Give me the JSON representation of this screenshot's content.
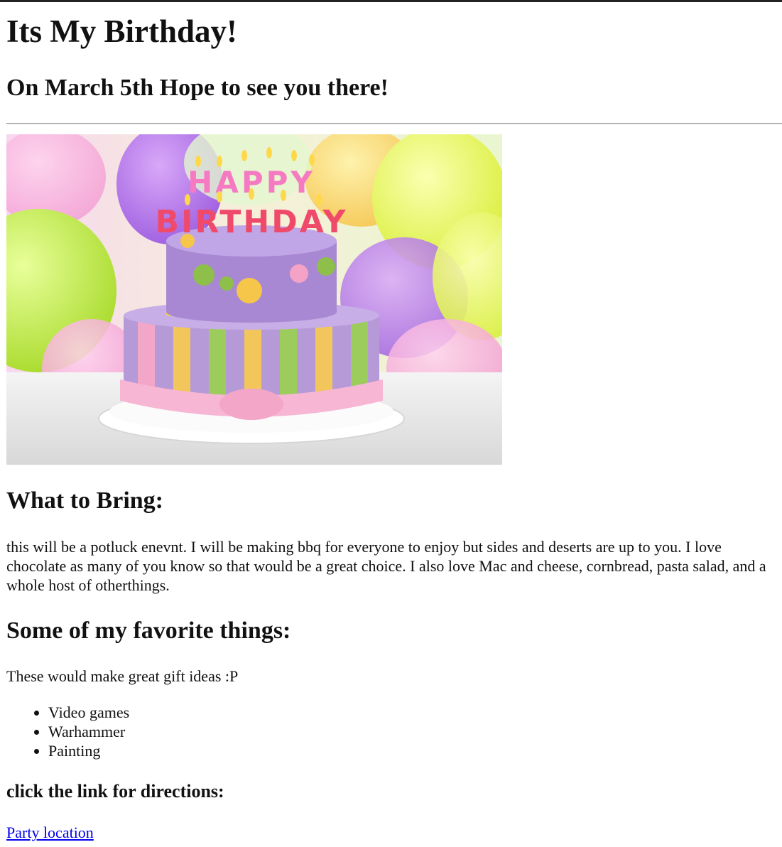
{
  "page": {
    "title": "Its My Birthday!",
    "subtitle": "On March 5th Hope to see you there!"
  },
  "photo": {
    "description_icon": "birthday-cake-image",
    "cake_text_top": "HAPPY",
    "cake_text_bottom": "BIRTHDAY"
  },
  "bring": {
    "heading": "What to Bring:",
    "text": "this will be a potluck enevnt. I will be making bbq for everyone to enjoy but sides and deserts are up to you. I love chocolate as many of you know so that would be a great choice. I also love Mac and cheese, cornbread, pasta salad, and a whole host of otherthings."
  },
  "favorites": {
    "heading": "Some of my favorite things:",
    "intro": "These would make great gift ideas :P",
    "items": [
      "Video games",
      "Warhammer",
      "Painting"
    ]
  },
  "directions": {
    "heading": "click the link for directions:",
    "link_text": "Party location"
  },
  "colors": {
    "link": "#0000ee",
    "top_border": "#222222"
  }
}
